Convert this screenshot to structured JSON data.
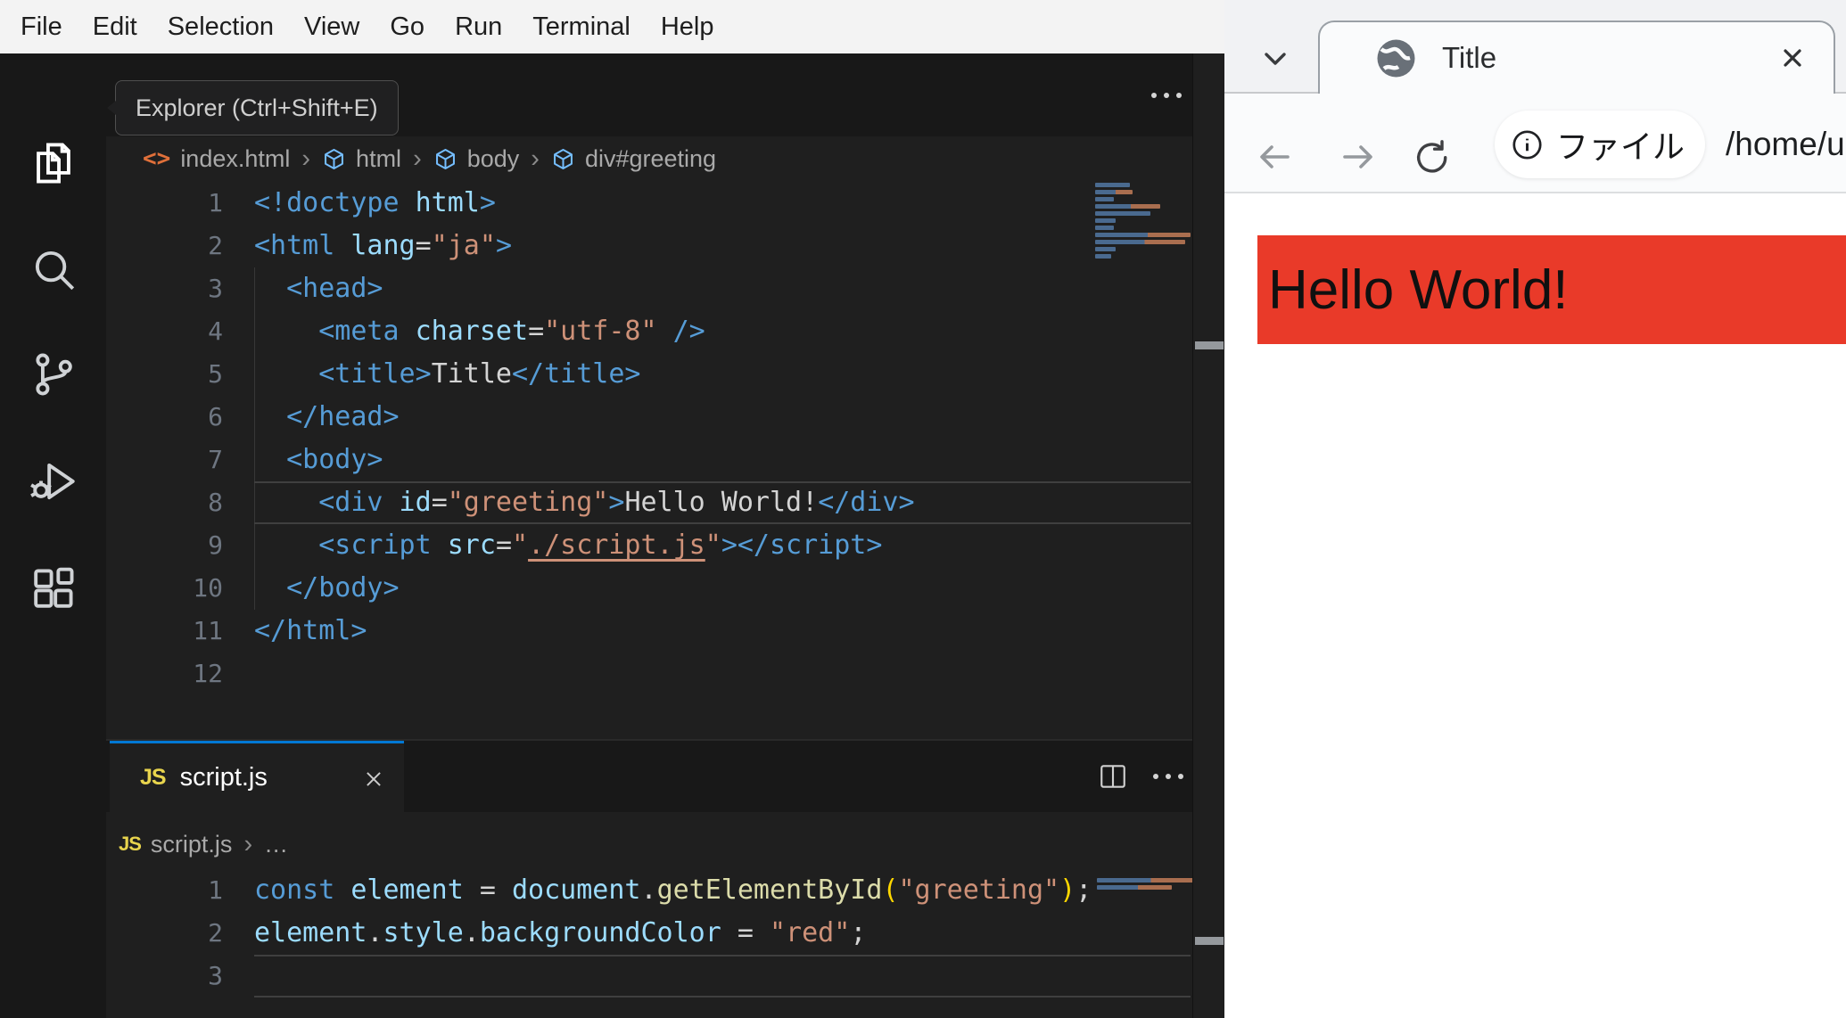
{
  "colors": {
    "accent_blue": "#0078d4",
    "editor_bg": "#1f1f1f",
    "banner_red": "#e93a29",
    "js_badge_yellow": "#e8d44d",
    "minimap_blue": "#4a6a8f",
    "minimap_orange": "#a96e4f"
  },
  "vscode": {
    "menu": [
      "File",
      "Edit",
      "Selection",
      "View",
      "Go",
      "Run",
      "Terminal",
      "Help"
    ],
    "tooltip": "Explorer (Ctrl+Shift+E)",
    "activity_items": [
      "explorer",
      "search",
      "source-control",
      "run-and-debug",
      "extensions"
    ],
    "crumb_separator": "›",
    "html_breadcrumb": {
      "file_icon": "<>",
      "file": "index.html",
      "segments": [
        "html",
        "body",
        "div#greeting"
      ]
    },
    "html_code": {
      "lines": [
        {
          "n": "1",
          "tokens": [
            [
              "<!doctype",
              "tag"
            ],
            [
              " html",
              "attr"
            ],
            [
              ">",
              "tag"
            ]
          ]
        },
        {
          "n": "2",
          "tokens": [
            [
              "<html",
              "tag"
            ],
            [
              " lang",
              "attr"
            ],
            [
              "=",
              "punc"
            ],
            [
              "\"ja\"",
              "str"
            ],
            [
              ">",
              "tag"
            ]
          ]
        },
        {
          "n": "3",
          "guide": true,
          "tokens": [
            [
              "  ",
              "ws"
            ],
            [
              "<head>",
              "tag"
            ]
          ]
        },
        {
          "n": "4",
          "guide": true,
          "tokens": [
            [
              "    ",
              "ws"
            ],
            [
              "<meta",
              "tag"
            ],
            [
              " charset",
              "attr"
            ],
            [
              "=",
              "punc"
            ],
            [
              "\"utf-8\"",
              "str"
            ],
            [
              " ",
              "ws"
            ],
            [
              "/>",
              "tag"
            ]
          ]
        },
        {
          "n": "5",
          "guide": true,
          "tokens": [
            [
              "    ",
              "ws"
            ],
            [
              "<title>",
              "tag"
            ],
            [
              "Title",
              "text"
            ],
            [
              "</title>",
              "tag"
            ]
          ]
        },
        {
          "n": "6",
          "guide": true,
          "tokens": [
            [
              "  ",
              "ws"
            ],
            [
              "</head>",
              "tag"
            ]
          ]
        },
        {
          "n": "7",
          "guide": true,
          "tokens": [
            [
              "  ",
              "ws"
            ],
            [
              "<body>",
              "tag"
            ]
          ]
        },
        {
          "n": "8",
          "guide": true,
          "current": true,
          "tokens": [
            [
              "    ",
              "ws"
            ],
            [
              "<div",
              "tag"
            ],
            [
              " id",
              "attr"
            ],
            [
              "=",
              "punc"
            ],
            [
              "\"greeting\"",
              "str"
            ],
            [
              ">",
              "tag"
            ],
            [
              "Hello World!",
              "text"
            ],
            [
              "</div>",
              "tag"
            ]
          ]
        },
        {
          "n": "9",
          "guide": true,
          "tokens": [
            [
              "    ",
              "ws"
            ],
            [
              "<script",
              "tag"
            ],
            [
              " src",
              "attr"
            ],
            [
              "=",
              "punc"
            ],
            [
              "\"",
              "str"
            ],
            [
              "./script.js",
              "link"
            ],
            [
              "\"",
              "str"
            ],
            [
              ">",
              "tag"
            ],
            [
              "</script>",
              "tag"
            ]
          ]
        },
        {
          "n": "10",
          "guide": true,
          "tokens": [
            [
              "  ",
              "ws"
            ],
            [
              "</body>",
              "tag"
            ]
          ]
        },
        {
          "n": "11",
          "tokens": [
            [
              "</html>",
              "tag"
            ]
          ]
        },
        {
          "n": "12",
          "tokens": []
        }
      ]
    },
    "panel_tab": {
      "badge": "JS",
      "label": "script.js"
    },
    "js_breadcrumb": {
      "badge": "JS",
      "file": "script.js",
      "more": "…"
    },
    "js_code": {
      "lines": [
        {
          "n": "1",
          "tokens": [
            [
              "const",
              "kw"
            ],
            [
              " element ",
              "attr"
            ],
            [
              "=",
              "punc"
            ],
            [
              " document",
              "attr"
            ],
            [
              ".",
              "punc"
            ],
            [
              "getElementById",
              "fn"
            ],
            [
              "(",
              "par"
            ],
            [
              "\"greeting\"",
              "str"
            ],
            [
              ")",
              "par"
            ],
            [
              ";",
              "punc"
            ]
          ]
        },
        {
          "n": "2",
          "tokens": [
            [
              "element",
              "attr"
            ],
            [
              ".",
              "punc"
            ],
            [
              "style",
              "attr"
            ],
            [
              ".",
              "punc"
            ],
            [
              "backgroundColor",
              "attr"
            ],
            [
              " ",
              "ws"
            ],
            [
              "=",
              "punc"
            ],
            [
              " ",
              "ws"
            ],
            [
              "\"red\"",
              "str"
            ],
            [
              ";",
              "punc"
            ]
          ]
        },
        {
          "n": "3",
          "current": true,
          "tokens": []
        }
      ]
    }
  },
  "browser": {
    "tab_title": "Title",
    "origin_chip": "ファイル",
    "url": "/home/u",
    "page_text": "Hello World!"
  }
}
